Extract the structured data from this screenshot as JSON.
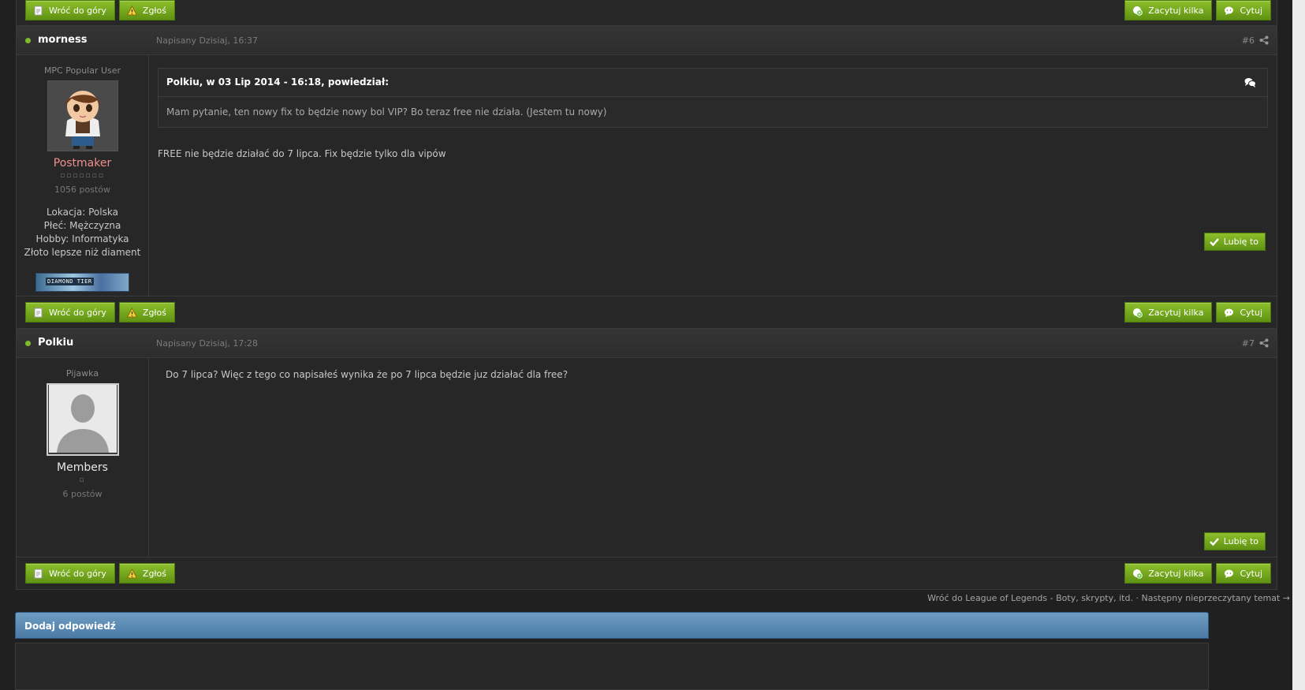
{
  "buttons": {
    "back_to_top": "Wróć do góry",
    "report": "Zgłoś",
    "multi_quote": "Zacytuj kilka",
    "quote": "Cytuj",
    "like": "Lubię to"
  },
  "posts": [
    {
      "author": "morness",
      "date": "Napisany Dzisiaj, 16:37",
      "number": "#6",
      "user_title": "MPC Popular User",
      "rank": "Postmaker",
      "rank_color": "#f08f8f",
      "pips": "▫▫▫▫▫▫▫",
      "post_count": "1056 postów",
      "fields": [
        "Lokacja: Polska",
        "Płeć: Mężczyzna",
        "Hobby: Informatyka",
        "Złoto lepsze niż diament"
      ],
      "tier_label": "DIAMOND TIER",
      "quote_title": "Polkiu, w 03 Lip 2014 - 16:18, powiedział:",
      "quote_text": "Mam pytanie, ten nowy fix to będzie nowy bol VIP? Bo teraz free nie działa. (Jestem tu nowy)",
      "message": "FREE nie będzie działać do 7 lipca. Fix będzie tylko dla vipów"
    },
    {
      "author": "Polkiu",
      "date": "Napisany Dzisiaj, 17:28",
      "number": "#7",
      "user_title": "Pijawka",
      "rank": "Members",
      "rank_color": "#e6e6e6",
      "pips": "▫",
      "post_count": "6 postów",
      "message": "Do 7 lipca? Więc z tego co napisałeś wynika że po 7 lipca będzie juz działać dla free?"
    }
  ],
  "footer": {
    "back_link": "Wróć do League of Legends - Boty, skrypty, itd.",
    "separator": " · ",
    "next_link": "Następny nieprzeczytany temat →"
  },
  "reply": {
    "title": "Dodaj odpowiedź"
  },
  "colors": {
    "accent_green": "#7dbb28",
    "reply_blue": "#5b89b3"
  }
}
